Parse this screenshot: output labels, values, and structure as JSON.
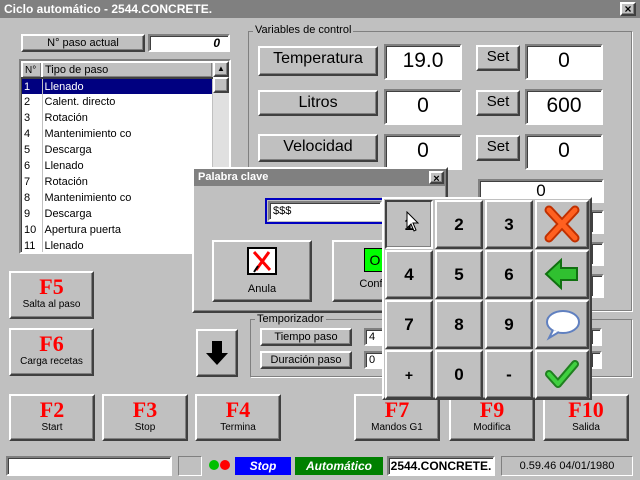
{
  "window": {
    "title": "Ciclo automático - 2544.CONCRETE."
  },
  "paso": {
    "label": "N° paso actual",
    "value": "0"
  },
  "list": {
    "headers": [
      "N°",
      "Tipo de paso"
    ],
    "rows": [
      {
        "n": "1",
        "tipo": "Llenado"
      },
      {
        "n": "2",
        "tipo": "Calent. directo"
      },
      {
        "n": "3",
        "tipo": "Rotación"
      },
      {
        "n": "4",
        "tipo": "Mantenimiento co"
      },
      {
        "n": "5",
        "tipo": "Descarga"
      },
      {
        "n": "6",
        "tipo": "Llenado"
      },
      {
        "n": "7",
        "tipo": "Rotación"
      },
      {
        "n": "8",
        "tipo": "Mantenimiento co"
      },
      {
        "n": "9",
        "tipo": "Descarga"
      },
      {
        "n": "10",
        "tipo": "Apertura puerta"
      },
      {
        "n": "11",
        "tipo": "Llenado"
      }
    ],
    "selected_row": 1
  },
  "vars": {
    "group_label": "Variables de control",
    "temperatura": {
      "label": "Temperatura",
      "value": "19.0",
      "set_label": "Set",
      "set_value": "0"
    },
    "litros": {
      "label": "Litros",
      "value": "0",
      "set_label": "Set",
      "set_value": "600"
    },
    "velocidad": {
      "label": "Velocidad",
      "value": "0",
      "set_label": "Set",
      "set_value": "0"
    },
    "extra_value": "0"
  },
  "temporizador": {
    "group_label": "Temporizador",
    "tiempo_label": "Tiempo  paso",
    "tiempo_value": "4",
    "duracion_label": "Duración paso",
    "duracion_value": "0"
  },
  "fkeys": {
    "f5": {
      "key": "F5",
      "label": "Salta al paso"
    },
    "f6": {
      "key": "F6",
      "label": "Carga recetas"
    },
    "f2": {
      "key": "F2",
      "label": "Start"
    },
    "f3": {
      "key": "F3",
      "label": "Stop"
    },
    "f4": {
      "key": "F4",
      "label": "Termina"
    },
    "f7": {
      "key": "F7",
      "label": "Mandos G1"
    },
    "f9": {
      "key": "F9",
      "label": "Modifica"
    },
    "f10": {
      "key": "F10",
      "label": "Salida"
    }
  },
  "dialog": {
    "title": "Palabra clave",
    "password": "$$$",
    "anula_label": "Anula",
    "confirma_label": "Conf",
    "confirma_glyph": "O"
  },
  "keypad": {
    "keys": [
      "1",
      "2",
      "3",
      "4",
      "5",
      "6",
      "7",
      "8",
      "9",
      "+",
      "0",
      "-"
    ]
  },
  "statusbar": {
    "stop_label": "Stop",
    "mode_label": "Automático",
    "machine": "2544.CONCRETE.",
    "datetime": "0.59.46  04/01/1980"
  },
  "colors": {
    "accent_red": "#ff0000",
    "stop_bg": "#0000ff",
    "mode_bg": "#008000",
    "selection": "#000080",
    "led_green": "#00c000",
    "led_red": "#ff0000"
  }
}
